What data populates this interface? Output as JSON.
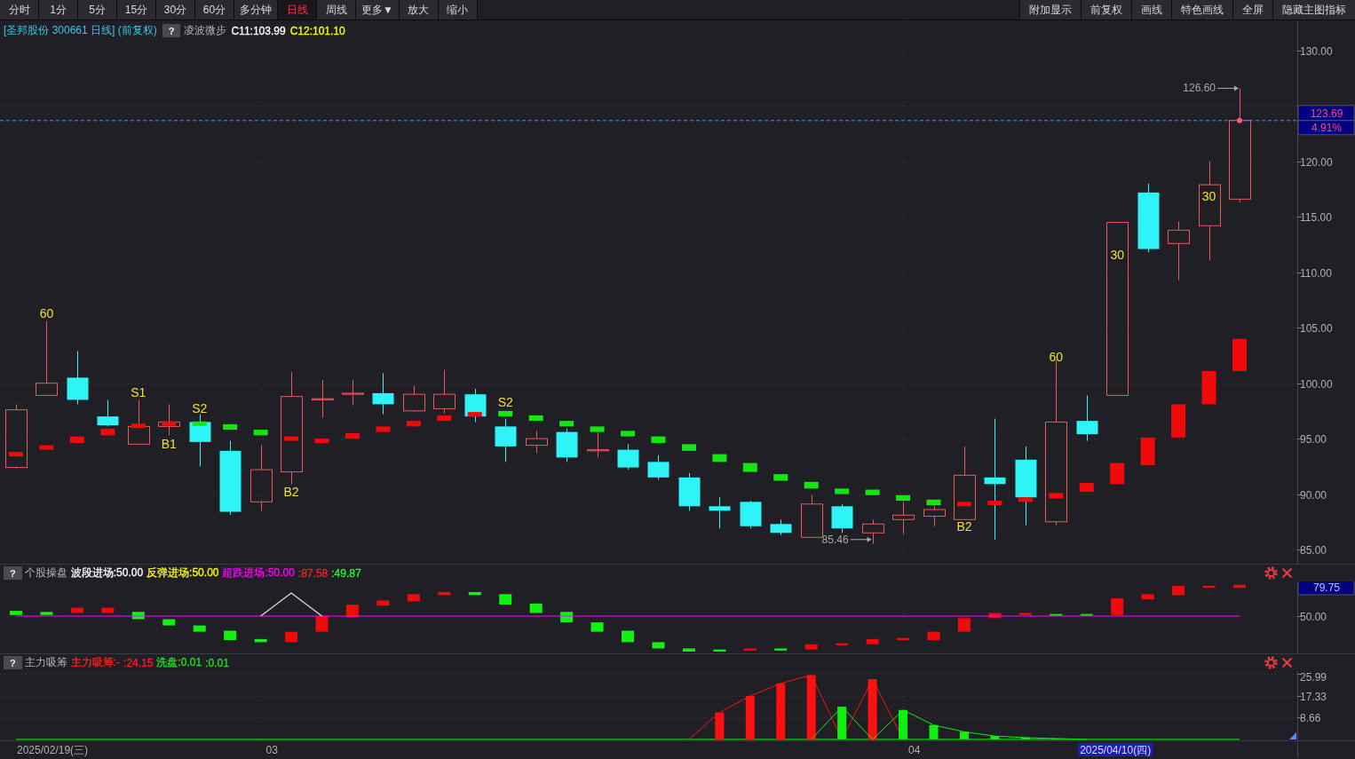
{
  "toolbar": {
    "left": [
      {
        "label": "分时",
        "selected": false
      },
      {
        "label": "1分",
        "selected": false
      },
      {
        "label": "5分",
        "selected": false
      },
      {
        "label": "15分",
        "selected": false
      },
      {
        "label": "30分",
        "selected": false
      },
      {
        "label": "60分",
        "selected": false
      },
      {
        "label": "多分钟",
        "selected": false
      },
      {
        "label": "日线",
        "selected": true
      },
      {
        "label": "周线",
        "selected": false
      },
      {
        "label": "更多▼",
        "selected": false
      },
      {
        "label": "放大",
        "selected": false
      },
      {
        "label": "缩小",
        "selected": false
      }
    ],
    "right": [
      "附加显示",
      "前复权",
      "画线",
      "特色画线",
      "全屏",
      "隐藏主图指标"
    ]
  },
  "main": {
    "header": {
      "title": "[圣邦股份 300661 日线] (前复权)",
      "help": "?",
      "indicator": "凌波微步",
      "values": [
        {
          "text": "C11:103.99",
          "color": "#ffffff"
        },
        {
          "text": "C12:101.10",
          "color": "#ffff00"
        }
      ]
    },
    "axis_labels": [
      "130.00",
      "120.00",
      "115.00",
      "110.00",
      "105.00",
      "100.00",
      "95.00",
      "90.00",
      "85.00"
    ],
    "signals": [
      "60",
      "S1",
      "B1",
      "S2",
      "B2",
      "S2",
      "B2",
      "60",
      "30",
      "30"
    ],
    "high_label": "126.60",
    "low_label": "85.46",
    "price_tag": "123.69",
    "change_tag": "4.91%"
  },
  "panels": [
    {
      "header": {
        "help": "?",
        "name": "个股操盘",
        "values": [
          {
            "text": "波段进场:50.00",
            "color": "#ffffff"
          },
          {
            "text": "反弹进场:50.00",
            "color": "#ffff00"
          },
          {
            "text": "超跌进场:50.00",
            "color": "#ff00ff"
          },
          {
            "text": ":87.58",
            "color": "#ff2020"
          },
          {
            "text": ":49.87",
            "color": "#20ff20"
          }
        ]
      },
      "axis_labels": [
        {
          "text": "79.75",
          "highlight": true
        },
        {
          "text": "50.00",
          "highlight": false
        }
      ]
    },
    {
      "header": {
        "help": "?",
        "name": "主力吸筹",
        "values": [
          {
            "text": "主力吸筹:-",
            "color": "#ff2020"
          },
          {
            "text": ":24.15",
            "color": "#ff2020"
          },
          {
            "text": "洗盘:0.01",
            "color": "#20e020"
          },
          {
            "text": ":0.01",
            "color": "#20e020"
          }
        ]
      },
      "axis_labels": [
        {
          "text": "25.99",
          "highlight": false
        },
        {
          "text": "17.33",
          "highlight": false
        },
        {
          "text": "8.66",
          "highlight": false
        }
      ]
    }
  ],
  "dates": [
    {
      "text": "2025/02/19(三)",
      "highlight": false
    },
    {
      "text": "03",
      "highlight": false
    },
    {
      "text": "04",
      "highlight": false
    },
    {
      "text": "2025/04/10(四)",
      "highlight": true
    }
  ]
}
